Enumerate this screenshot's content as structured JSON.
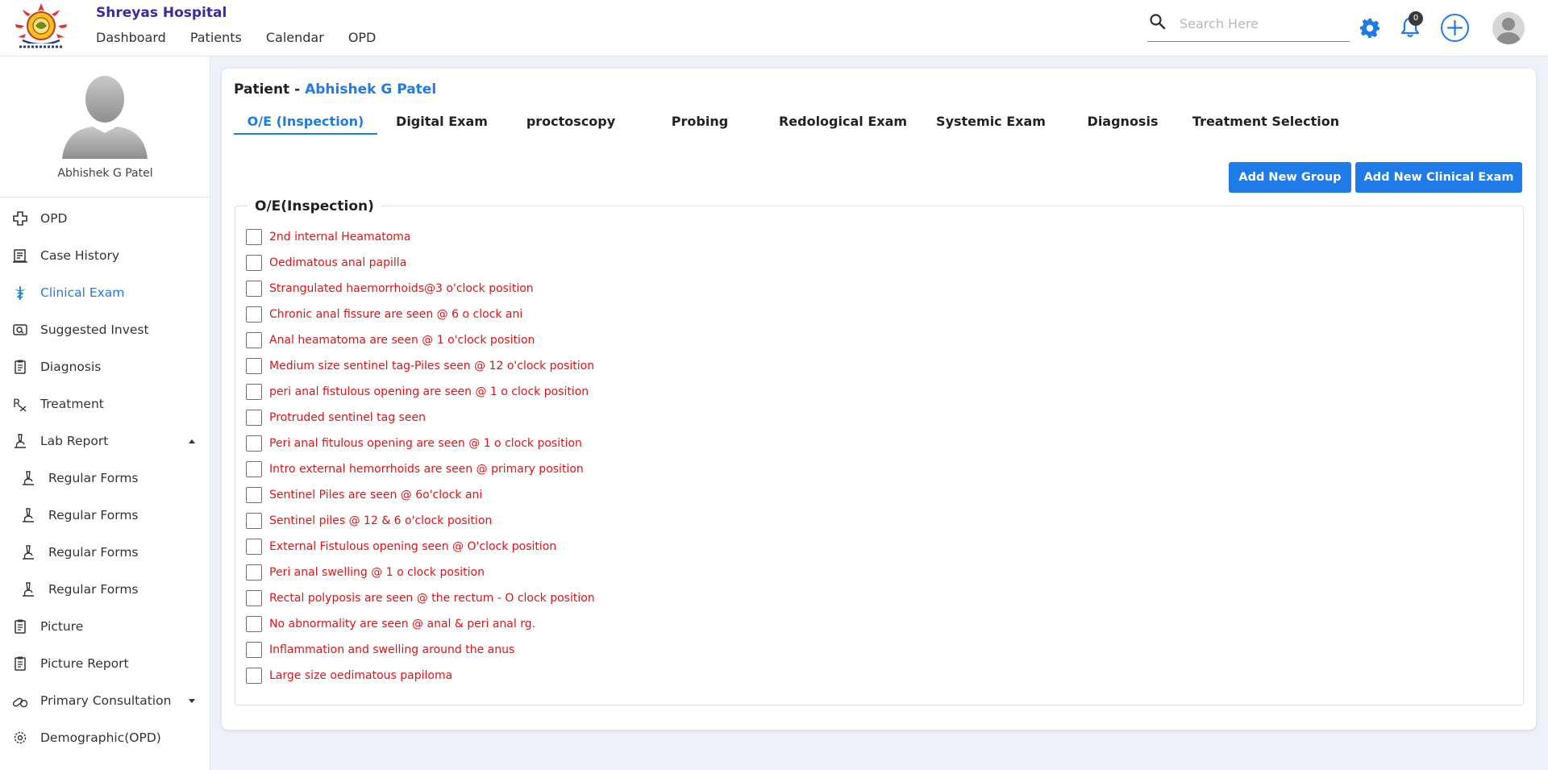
{
  "app": {
    "hospital_name": "Shreyas Hospital",
    "nav": [
      "Dashboard",
      "Patients",
      "Calendar",
      "OPD"
    ]
  },
  "search": {
    "placeholder": "Search Here"
  },
  "notifications": {
    "count": "0"
  },
  "icons": {
    "search": "search-icon",
    "settings": "gear-icon",
    "notifications": "bell-icon",
    "add": "plus-circle-icon",
    "user": "user-avatar-icon"
  },
  "colors": {
    "accent": "#1e7be8",
    "brand": "#3b2aa8",
    "checklist_text": "#e01414"
  },
  "sidebar": {
    "profile_name": "Abhishek G Patel",
    "items": [
      {
        "label": "OPD",
        "icon": "medical-cross-icon"
      },
      {
        "label": "Case History",
        "icon": "case-history-icon"
      },
      {
        "label": "Clinical Exam",
        "icon": "caduceus-icon",
        "active": true
      },
      {
        "label": "Suggested Invest",
        "icon": "investigation-icon"
      },
      {
        "label": "Diagnosis",
        "icon": "clipboard-icon"
      },
      {
        "label": "Treatment",
        "icon": "rx-icon"
      },
      {
        "label": "Lab Report",
        "icon": "microscope-icon",
        "expanded": true
      },
      {
        "label": "Regular Forms",
        "icon": "microscope-icon",
        "sub": true
      },
      {
        "label": "Regular Forms",
        "icon": "microscope-icon",
        "sub": true
      },
      {
        "label": "Regular Forms",
        "icon": "microscope-icon",
        "sub": true
      },
      {
        "label": "Regular Forms",
        "icon": "microscope-icon",
        "sub": true
      },
      {
        "label": "Picture",
        "icon": "clipboard-icon"
      },
      {
        "label": "Picture Report",
        "icon": "clipboard-icon"
      },
      {
        "label": "Primary Consultation",
        "icon": "pills-icon",
        "collapsed": true
      },
      {
        "label": "Demographic(OPD)",
        "icon": "gear-outline-icon"
      }
    ]
  },
  "main": {
    "patient_label": "Patient - ",
    "patient_name": "Abhishek G Patel",
    "tabs": [
      {
        "label": "O/E (Inspection)",
        "active": true
      },
      {
        "label": "Digital Exam"
      },
      {
        "label": "proctoscopy"
      },
      {
        "label": "Probing"
      },
      {
        "label": "Redological Exam"
      },
      {
        "label": "Systemic Exam"
      },
      {
        "label": "Diagnosis"
      },
      {
        "label": "Treatment Selection"
      }
    ],
    "add_group_label": "Add New Group",
    "add_exam_label": "Add New Clinical Exam",
    "section_title": "O/E(Inspection)",
    "checklist": [
      "2nd internal Heamatoma",
      "Oedimatous anal papilla",
      "Strangulated haemorrhoids@3 o'clock position",
      "Chronic anal fissure are seen @ 6 o clock ani",
      "Anal heamatoma are seen @ 1 o'clock position",
      "Medium size sentinel tag-Piles seen @ 12 o'clock position",
      "peri anal fistulous opening are seen @ 1 o clock position",
      "Protruded sentinel tag seen",
      "Peri anal fitulous opening are seen @ 1 o clock position",
      "Intro external hemorrhoids are seen @ primary position",
      "Sentinel Piles are seen @ 6o'clock ani",
      "Sentinel piles @ 12 & 6 o'clock position",
      "External Fistulous opening seen @ O'clock position",
      "Peri anal swelling @ 1 o clock position",
      "Rectal polyposis are seen @ the rectum - O clock position",
      "No abnormality are seen @ anal & peri anal rg.",
      "Inflammation and swelling around the anus",
      "Large size oedimatous papiloma"
    ]
  }
}
